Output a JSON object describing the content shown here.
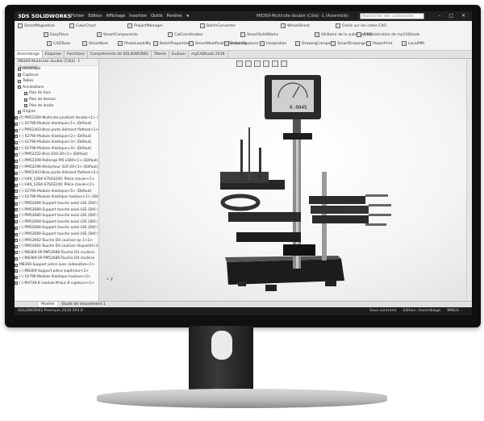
{
  "app": {
    "logo": "3DS SOLIDWORKS",
    "menus": [
      "Fichier",
      "Edition",
      "Affichage",
      "Insertion",
      "Outils",
      "Fenêtre",
      "★"
    ],
    "window_title": "M8369-Multicote double (Côté) -1 (Assemblé)",
    "search_placeholder": "Rechercher des commandes"
  },
  "ribbon": {
    "items": [
      "SmartMagnetize",
      "EasyPlace",
      "ColorChart",
      "SmartComponents",
      "ProjectManager",
      "CatCoordinates",
      "BatchConverter",
      "SmartSolidWorks",
      "WheelSheet",
      "Utilitaire de la suite myCAD",
      "Outils sur les cotes CAO",
      "Administration de myCADtools"
    ],
    "small_items": [
      "CADTools",
      "SmartBom",
      "PhotoLoadsMy",
      "BatchProperties",
      "SmartModificationSurfacing",
      "ProjectExplorer",
      "Integration",
      "DrawingCompare",
      "SmartDrawings",
      "PowerPrint",
      "LocalPMI"
    ]
  },
  "tabs": [
    "Assemblage",
    "Esquisse",
    "Fonctions",
    "Compléments de SOLIDWORKS",
    "Tôlerie",
    "Evaluer",
    "myCADtools 2018"
  ],
  "tree": {
    "header": "M8369-Multicote double (Côté) -1 (Assemblé)",
    "rows": [
      "Historique",
      "Capteurs",
      "Tables",
      "Annotations",
      "Plan de face",
      "Plan de dessus",
      "Plan de droite",
      "Origine",
      "(f) PM52280-Multicote pivotant double<1> (Défaut)",
      "(-) X2790-Module élastique<1> (Défaut)",
      "(-) PM52403-Bras porte élément flottant<1>",
      "(-) X2790-Module élastique<2> (Défaut)",
      "(-) X2790-Module élastique<3> (Défaut)",
      "(-) X2790-Module élastique<4> (Défaut)",
      "(-) PM52252-Bras 020-20<1> (Défaut)",
      "(-) PM52309-Rallonge M5 L080<1> (Défaut)",
      "(-) PM52296-Réducteur 020-20<1> (Défaut)",
      "(-) PM52403-Bras porte élément flottant<2>",
      "(-) H49_12B4-S7S03240: Pièce clavier<1>",
      "(-) H49_12B4-S7S03240: Pièce clavier<2>",
      "(-) X2790-Module élastique<5> (Défaut)",
      "(-) X2790-Module élastique hauteur<1> (Défaut)",
      "(-) PM52680-Support touche axial LSS (Déf.)",
      "(-) PM52680-Support touche axial LSS (Déf.)",
      "(-) PM52680-Support touche axial LSS (Déf.)",
      "(-) PM52680-Support touche axial LSS (Déf.)",
      "(-) PM52680-Support touche axial LSS (Déf.)",
      "(-) PM52680-Support touche axial LSS (Déf.)",
      "(-) PM52662-Touche D4 coulisse ep 1<2>",
      "(-) PM52681-Touche D4 coulisse dispositif<3>",
      "(-) M8369-SP-PM52680-Touche D4 coulisse",
      "(-) M8369-SP-PM52680-Touche D4 coulisse",
      "M8369-Support pièce avec indexation<1>",
      "(-) M8369-Support pièce supérieur<1>",
      "(-) X2790-Module élastique hauteur<3>",
      "(-) M4748-B module M bus 8 capteurs<1>"
    ]
  },
  "viewport": {
    "display_value": "0.0045",
    "triad_label": "y"
  },
  "docbar": {
    "tabs": [
      "Modèle",
      "Etude de mouvement 1"
    ]
  },
  "status": {
    "left": "SOLIDWORKS Premium 2018 SP3.0",
    "right": [
      "Sous-contraint",
      "Edition: Assemblage",
      "MMGS"
    ]
  },
  "colors": {
    "titlebar": "#202020",
    "screen_bg": "#eaeaea",
    "bezel": "#101010"
  }
}
